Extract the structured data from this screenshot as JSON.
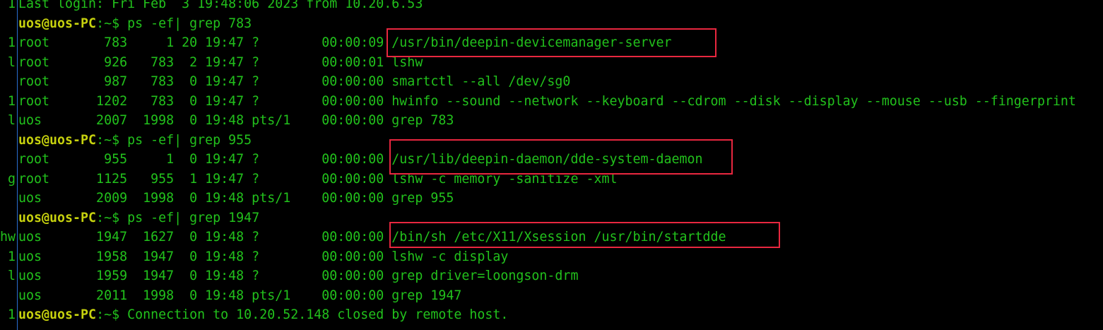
{
  "colors": {
    "background": "#000000",
    "text": "#22c11c",
    "prompt_user": "#c6d10e",
    "gutter_rule": "#2a6fd0",
    "highlight_box": "#e8273f"
  },
  "lines": [
    {
      "g": "1",
      "type": "text",
      "text": "Last login: Fri Feb  3 19:48:06 2023 from 10.20.6.53"
    },
    {
      "g": "",
      "type": "prompt",
      "user": "uos@uos-PC",
      "path": ":~$ ",
      "cmd": "ps -ef| grep 783"
    },
    {
      "g": "1",
      "type": "text",
      "text": "root       783     1 20 19:47 ?        00:00:09 /usr/bin/deepin-devicemanager-server"
    },
    {
      "g": "l",
      "type": "text",
      "text": "root       926   783  2 19:47 ?        00:00:01 lshw"
    },
    {
      "g": "",
      "type": "text",
      "text": "root       987   783  0 19:47 ?        00:00:00 smartctl --all /dev/sg0"
    },
    {
      "g": "1",
      "type": "text",
      "text": "root      1202   783  0 19:47 ?        00:00:00 hwinfo --sound --network --keyboard --cdrom --disk --display --mouse --usb --fingerprint"
    },
    {
      "g": "l",
      "type": "text",
      "text": "uos       2007  1998  0 19:48 pts/1    00:00:00 grep 783"
    },
    {
      "g": "",
      "type": "prompt",
      "user": "uos@uos-PC",
      "path": ":~$ ",
      "cmd": "ps -ef| grep 955"
    },
    {
      "g": "",
      "type": "text",
      "text": "root       955     1  0 19:47 ?        00:00:00 /usr/lib/deepin-daemon/dde-system-daemon"
    },
    {
      "g": "g",
      "type": "text",
      "text": "root      1125   955  1 19:47 ?        00:00:00 lshw -c memory -sanitize -xml"
    },
    {
      "g": "",
      "type": "text",
      "text": "uos       2009  1998  0 19:48 pts/1    00:00:00 grep 955"
    },
    {
      "g": "",
      "type": "prompt",
      "user": "uos@uos-PC",
      "path": ":~$ ",
      "cmd": "ps -ef| grep 1947"
    },
    {
      "g": "hw",
      "type": "text",
      "text": "uos       1947  1627  0 19:48 ?        00:00:00 /bin/sh /etc/X11/Xsession /usr/bin/startdde"
    },
    {
      "g": "1",
      "type": "text",
      "text": "uos       1958  1947  0 19:48 ?        00:00:00 lshw -c display"
    },
    {
      "g": "l",
      "type": "text",
      "text": "uos       1959  1947  0 19:48 ?        00:00:00 grep driver=loongson-drm"
    },
    {
      "g": "",
      "type": "text",
      "text": "uos       2011  1998  0 19:48 pts/1    00:00:00 grep 1947"
    },
    {
      "g": "1",
      "type": "prompt",
      "user": "uos@uos-PC",
      "path": ":~$ ",
      "cmd": "Connection to 10.20.52.148 closed by remote host."
    }
  ]
}
